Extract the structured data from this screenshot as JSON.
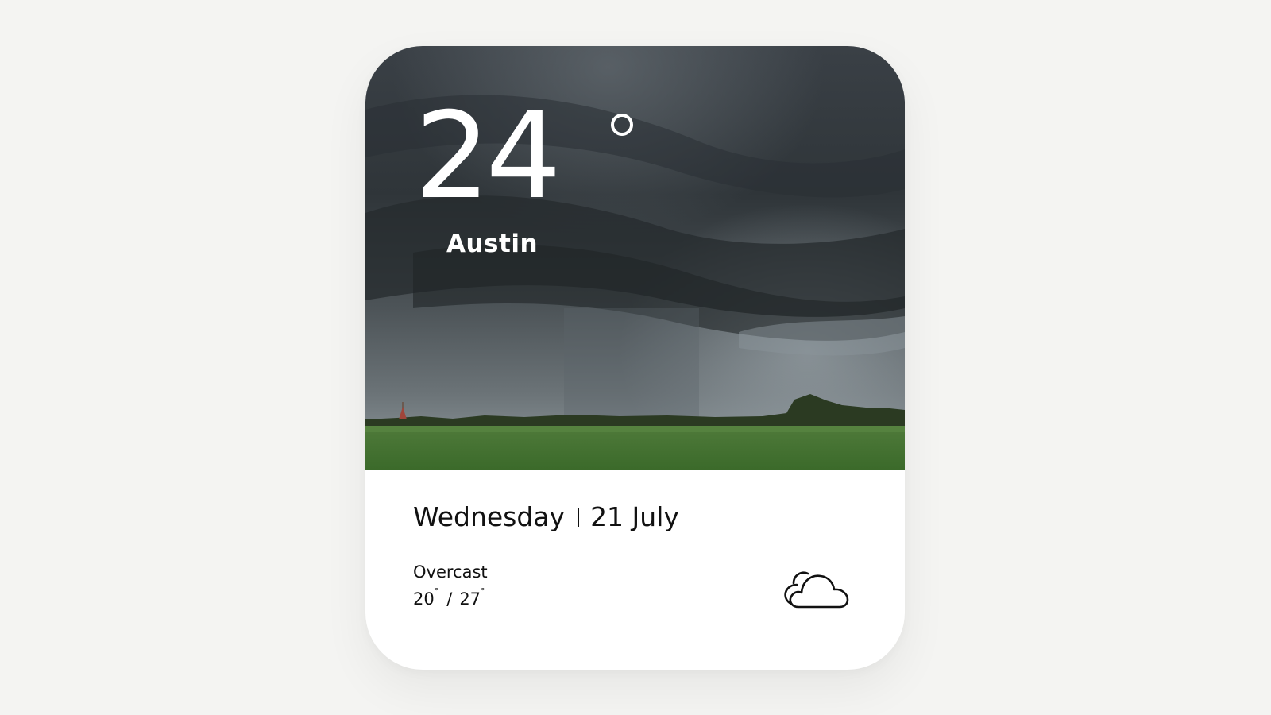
{
  "weather": {
    "temperature": "24",
    "temperature_unit_symbol": "°",
    "city": "Austin",
    "day": "Wednesday",
    "date": "21 July",
    "condition": "Overcast",
    "low": "20",
    "high": "27",
    "degree_symbol": "°",
    "range_separator": "/",
    "icon": "cloud-icon"
  },
  "colors": {
    "page_background": "#f4f4f2",
    "card_background": "#ffffff",
    "text_primary": "#111111",
    "text_on_image": "#ffffff"
  }
}
